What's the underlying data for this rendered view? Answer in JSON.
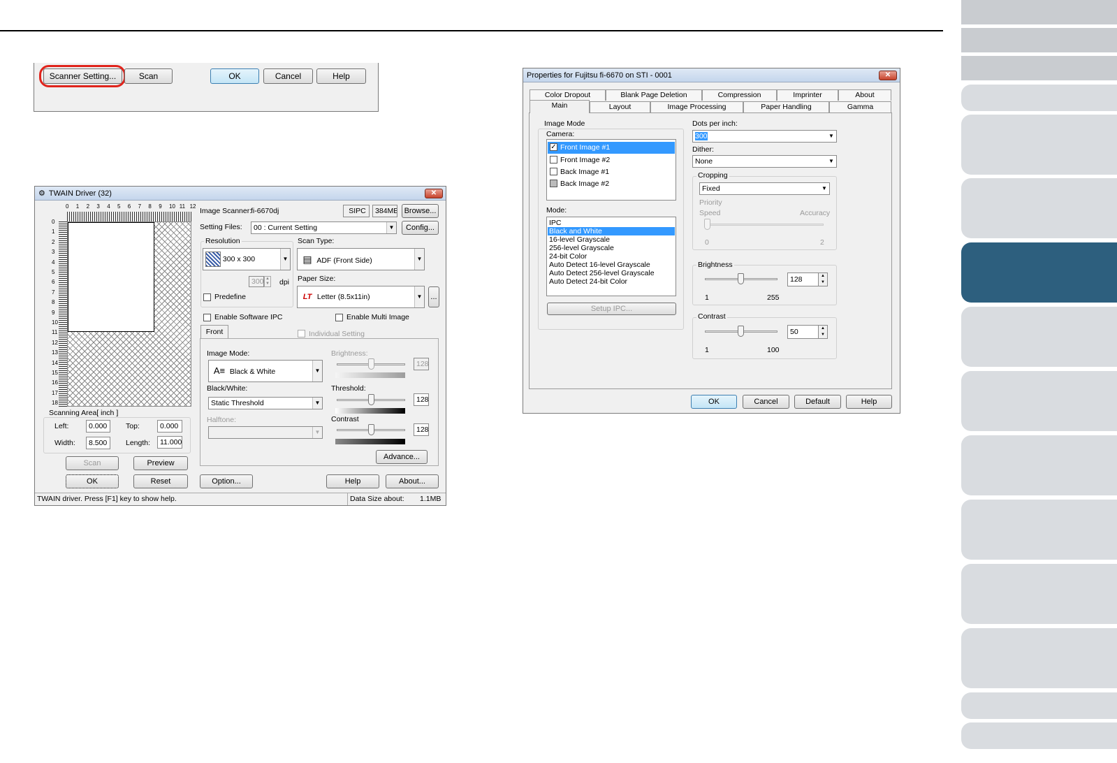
{
  "sidebar": {
    "tabs": [
      "",
      "",
      "",
      "",
      "",
      "",
      "",
      "",
      "",
      "",
      "",
      "",
      "",
      ""
    ]
  },
  "top_dialog": {
    "buttons": {
      "scanner_setting": "Scanner Setting...",
      "scan": "Scan",
      "ok": "OK",
      "cancel": "Cancel",
      "help": "Help"
    }
  },
  "twain": {
    "title": "TWAIN Driver (32)",
    "ruler_top": [
      "0",
      "1",
      "2",
      "3",
      "4",
      "5",
      "6",
      "7",
      "8",
      "9",
      "10",
      "11",
      "12"
    ],
    "ruler_left": [
      "0",
      "1",
      "2",
      "3",
      "4",
      "5",
      "6",
      "7",
      "8",
      "9",
      "10",
      "11",
      "12",
      "13",
      "14",
      "15",
      "16",
      "17",
      "18"
    ],
    "image_scanner_label": "Image Scanner:",
    "image_scanner_value": "fi-6670dj",
    "sipc": "SIPC",
    "memory": "384MB",
    "browse": "Browse...",
    "setting_files_label": "Setting Files:",
    "setting_files_value": "00 : Current Setting",
    "config": "Config...",
    "resolution_label": "Resolution",
    "resolution_value": "300 x 300",
    "dpi_value": "300",
    "dpi_unit": "dpi",
    "predefine": "Predefine",
    "scan_type_label": "Scan Type:",
    "scan_type_value": "ADF (Front Side)",
    "paper_size_label": "Paper Size:",
    "paper_size_value": "Letter (8.5x11in)",
    "paper_more": "...",
    "lt_icon": "LT",
    "enable_software_ipc": "Enable Software IPC",
    "enable_multi_image": "Enable Multi Image",
    "front_tab": "Front",
    "individual_setting": "Individual Setting",
    "image_mode_label": "Image Mode:",
    "image_mode_value": "Black & White",
    "bw_label": "Black/White:",
    "bw_value": "Static Threshold",
    "halftone_label": "Halftone:",
    "brightness_label": "Brightness:",
    "brightness_value": "128",
    "threshold_label": "Threshold:",
    "threshold_value": "128",
    "contrast_label": "Contrast",
    "contrast_value": "128",
    "advance": "Advance...",
    "scanning_area_label": "Scanning Area[ inch ]",
    "left_label": "Left:",
    "left_value": "0.000",
    "top_label": "Top:",
    "top_value": "0.000",
    "width_label": "Width:",
    "width_value": "8.500",
    "length_label": "Length:",
    "length_value": "11.000",
    "btn_scan": "Scan",
    "btn_preview": "Preview",
    "btn_ok": "OK",
    "btn_reset": "Reset",
    "btn_option": "Option...",
    "btn_help": "Help",
    "btn_about": "About...",
    "status_text": "TWAIN driver. Press [F1] key to show help.",
    "data_size_label": "Data Size about:",
    "data_size_value": "1.1MB"
  },
  "props": {
    "title": "Properties for Fujitsu fi-6670 on STI - 0001",
    "tabs_row1": [
      "Color Dropout",
      "Blank Page Deletion",
      "Compression",
      "Imprinter",
      "About"
    ],
    "tabs_row2": [
      "Main",
      "Layout",
      "Image Processing",
      "Paper Handling",
      "Gamma"
    ],
    "image_mode_label": "Image Mode",
    "camera_label": "Camera:",
    "camera_items": [
      "Front Image #1",
      "Front Image #2",
      "Back Image #1",
      "Back Image #2"
    ],
    "mode_label": "Mode:",
    "mode_items": [
      "IPC",
      "Black and White",
      "16-level Grayscale",
      "256-level Grayscale",
      "24-bit Color",
      "Auto Detect 16-level Grayscale",
      "Auto Detect 256-level Grayscale",
      "Auto Detect 24-bit Color"
    ],
    "setup_ipc": "Setup IPC...",
    "dpi_label": "Dots per inch:",
    "dpi_value": "300",
    "dither_label": "Dither:",
    "dither_value": "None",
    "cropping_label": "Cropping",
    "cropping_value": "Fixed",
    "priority_label": "Priority",
    "speed_label": "Speed",
    "accuracy_label": "Accuracy",
    "priority_min": "0",
    "priority_max": "2",
    "brightness_label": "Brightness",
    "brightness_value": "128",
    "brightness_min": "1",
    "brightness_max": "255",
    "contrast_label": "Contrast",
    "contrast_value": "50",
    "contrast_min": "1",
    "contrast_max": "100",
    "btn_ok": "OK",
    "btn_cancel": "Cancel",
    "btn_default": "Default",
    "btn_help": "Help"
  },
  "colors": {
    "highlight_circle": "#e0241c",
    "active_tab": "#2d5f7e",
    "selection": "#3399ff"
  }
}
